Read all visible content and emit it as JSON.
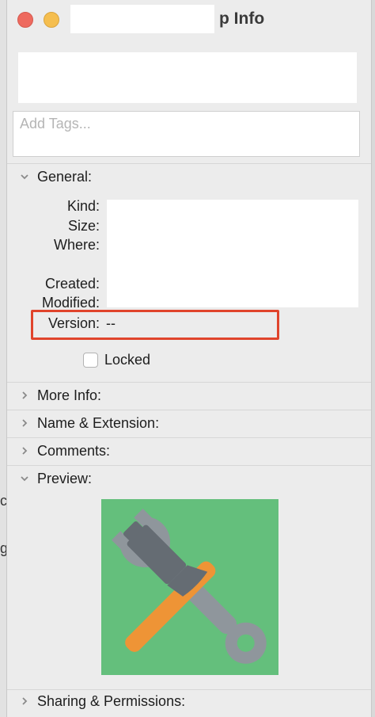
{
  "window": {
    "title": "p Info"
  },
  "tags": {
    "placeholder": "Add Tags..."
  },
  "general": {
    "header": "General:",
    "rows": [
      {
        "label": "Kind:"
      },
      {
        "label": "Size:"
      },
      {
        "label": "Where:"
      },
      {
        "label": "Created:"
      },
      {
        "label": "Modified:"
      }
    ],
    "version_label": "Version:",
    "version_value": "--",
    "locked_label": "Locked"
  },
  "sections": {
    "more_info": "More Info:",
    "name_extension": "Name & Extension:",
    "comments": "Comments:",
    "preview": "Preview:",
    "sharing": "Sharing & Permissions:"
  },
  "icons": {
    "collapsed": "chevron-right-icon",
    "expanded": "chevron-down-icon",
    "preview": "hammer-wrench-icon"
  },
  "colors": {
    "preview_bg": "#64bf7c",
    "hammer_handle": "#ee9436",
    "hammer_head": "#656c73",
    "wrench": "#8f969c",
    "highlight": "#e0442c",
    "close": "#ee6a5f",
    "minimize": "#f5be4f"
  }
}
